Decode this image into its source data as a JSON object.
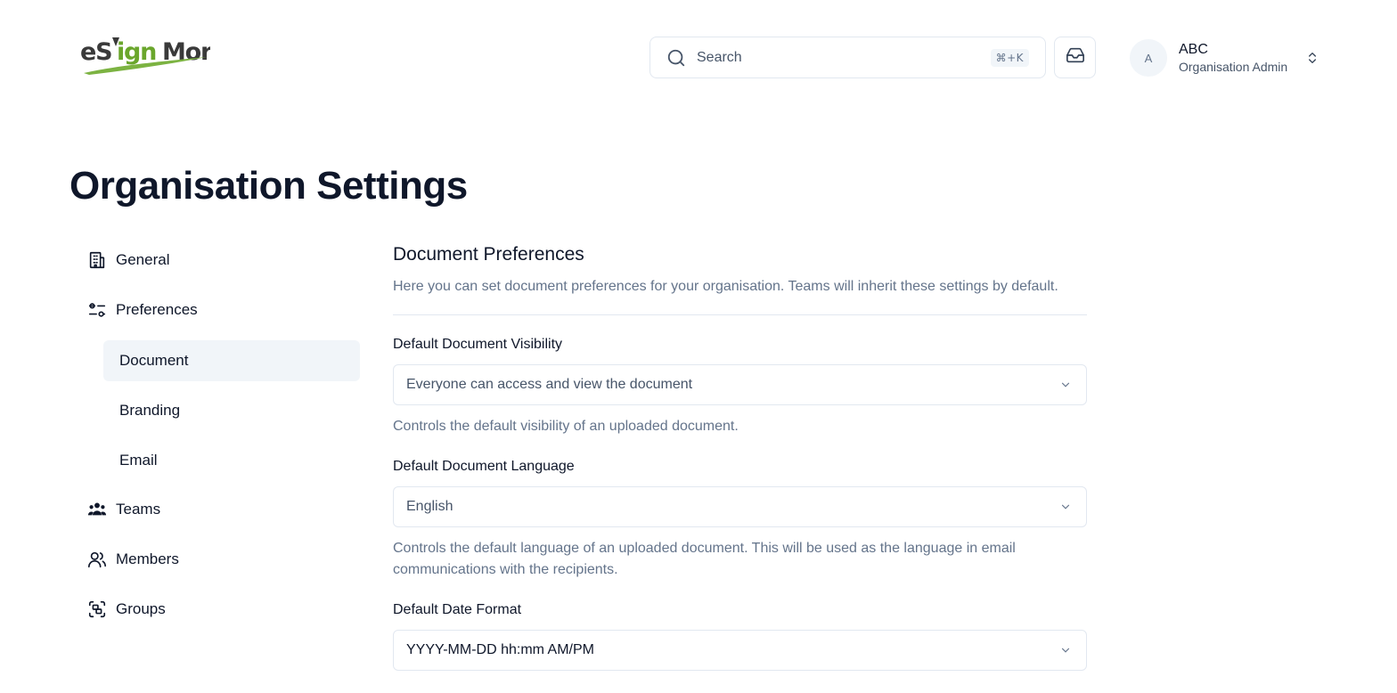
{
  "header": {
    "logo_alt": "eSignMor",
    "search": {
      "placeholder": "Search",
      "shortcut": "⌘+K"
    },
    "inbox_icon": "inbox-icon",
    "profile": {
      "avatar_initial": "A",
      "name": "ABC",
      "role": "Organisation Admin"
    }
  },
  "page": {
    "title": "Organisation Settings"
  },
  "sidebar": {
    "items": [
      {
        "label": "General",
        "icon": "building-icon"
      },
      {
        "label": "Preferences",
        "icon": "sliders-icon"
      },
      {
        "label": "Document",
        "active": true
      },
      {
        "label": "Branding"
      },
      {
        "label": "Email"
      },
      {
        "label": "Teams",
        "icon": "users-icon"
      },
      {
        "label": "Members",
        "icon": "user-icon"
      },
      {
        "label": "Groups",
        "icon": "group-icon"
      }
    ]
  },
  "main": {
    "section_title": "Document Preferences",
    "section_desc": "Here you can set document preferences for your organisation. Teams will inherit these settings by default.",
    "fields": [
      {
        "label": "Default Document Visibility",
        "value": "Everyone can access and view the document",
        "help": "Controls the default visibility of an uploaded document."
      },
      {
        "label": "Default Document Language",
        "value": "English",
        "help": "Controls the default language of an uploaded document. This will be used as the language in email communications with the recipients."
      },
      {
        "label": "Default Date Format",
        "value": "YYYY-MM-DD hh:mm AM/PM"
      }
    ]
  },
  "colors": {
    "brand_dark": "#3a3a3a",
    "brand_green": "#7cb342",
    "active_bg": "#f1f5f9",
    "border": "#e2e8f0",
    "muted_text": "#64748b"
  }
}
